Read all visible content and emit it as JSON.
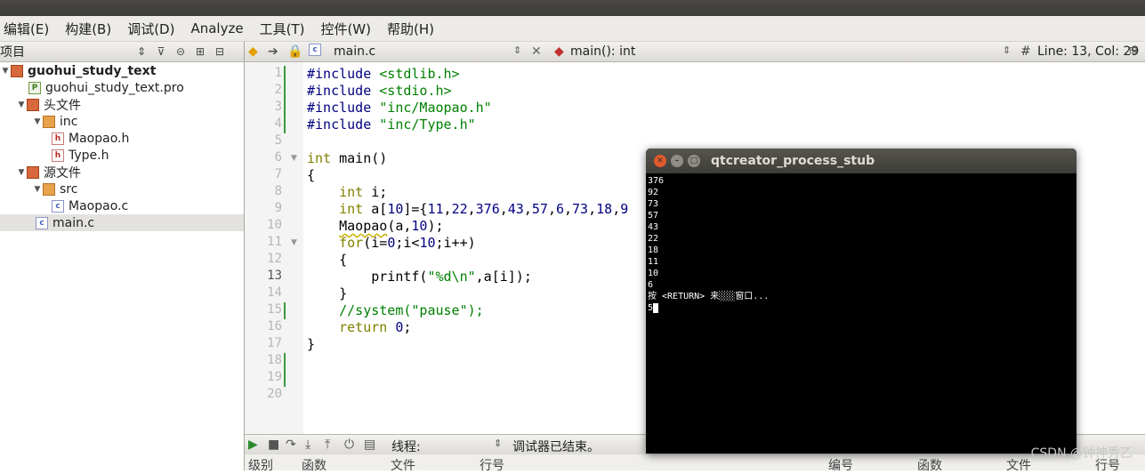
{
  "menu": [
    "编辑(E)",
    "构建(B)",
    "调试(D)",
    "Analyze",
    "工具(T)",
    "控件(W)",
    "帮助(H)"
  ],
  "project_panel": {
    "title": "项目",
    "tree": [
      {
        "label": "guohui_study_text",
        "icon": "project-folder-icon",
        "bold": true
      },
      {
        "label": "guohui_study_text.pro",
        "icon": "pro-file-icon"
      },
      {
        "label": "头文件",
        "icon": "folder-icon"
      },
      {
        "label": "inc",
        "icon": "folder-icon"
      },
      {
        "label": "Maopao.h",
        "icon": "h-file-icon"
      },
      {
        "label": "Type.h",
        "icon": "h-file-icon"
      },
      {
        "label": "源文件",
        "icon": "folder-icon"
      },
      {
        "label": "src",
        "icon": "folder-icon"
      },
      {
        "label": "Maopao.c",
        "icon": "c-file-icon"
      },
      {
        "label": "main.c",
        "icon": "c-file-icon",
        "selected": true
      }
    ]
  },
  "editor": {
    "file_tab": "main.c",
    "function_combo": "main(): int",
    "position": "Line: 13, Col: 29",
    "line_numbers": [
      "1",
      "2",
      "3",
      "4",
      "5",
      "6",
      "7",
      "8",
      "9",
      "10",
      "11",
      "12",
      "13",
      "14",
      "15",
      "16",
      "17",
      "18",
      "19",
      "20"
    ],
    "current_line": 13
  },
  "debugger": {
    "thread_label": "线程:",
    "status": "调试器已结束。",
    "columns_left": [
      "级别",
      "函数",
      "文件",
      "行号"
    ],
    "columns_right": [
      "编号",
      "函数",
      "文件",
      "行号"
    ]
  },
  "terminal": {
    "title": "qtcreator_process_stub",
    "output": "376\n92\n73\n57\n43\n22\n18\n11\n10\n6\n按 <RETURN> 来░░░窗口...\n5"
  },
  "watermark": "CSDN @钟神秀乙"
}
